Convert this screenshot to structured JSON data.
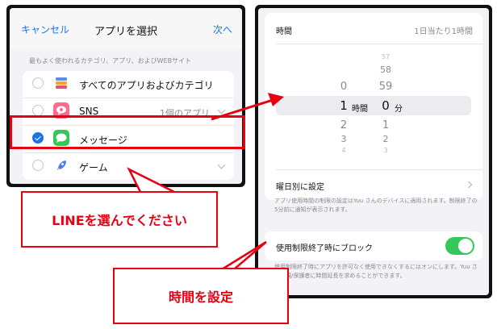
{
  "left_screen": {
    "nav": {
      "cancel": "キャンセル",
      "title": "アプリを選択",
      "next": "次へ"
    },
    "section_header": "最もよく使われるカテゴリ、アプリ、およびWEBサイト",
    "rows": [
      {
        "label": "すべてのアプリおよびカテゴリ",
        "detail": "",
        "checked": false
      },
      {
        "label": "SNS",
        "detail": "1個のアプリ",
        "checked": false
      },
      {
        "label": "メッセージ",
        "detail": "",
        "checked": true
      },
      {
        "label": "ゲーム",
        "detail": "",
        "checked": false
      }
    ]
  },
  "right_screen": {
    "time_label": "時間",
    "time_value": "1日当たり1時間",
    "picker": {
      "hours_above": [
        "0"
      ],
      "hours_selected": "1",
      "hours_below": [
        "2",
        "3",
        "4"
      ],
      "hour_unit": "時間",
      "minutes_above": [
        "57",
        "58",
        "59"
      ],
      "minutes_selected": "0",
      "minutes_below": [
        "1",
        "2",
        "3"
      ],
      "minute_unit": "分"
    },
    "weekday_label": "曜日別に設定",
    "note1": "アプリ使用時間の制限の設定はYuu さんのデバイスに適用されます。制限終了の5分前に通知が表示されます。",
    "block_label": "使用制限終了時にブロック",
    "block_toggle": true,
    "note2": "使用制限終了時にアプリを許可なく使用できなくするにはオンにします。Yuu さんは親/保護者に時間延長を求めることができます。"
  },
  "annotations": {
    "callout_line": "LINEを選んでください",
    "callout_time": "時間を設定",
    "color": "#e60012"
  }
}
